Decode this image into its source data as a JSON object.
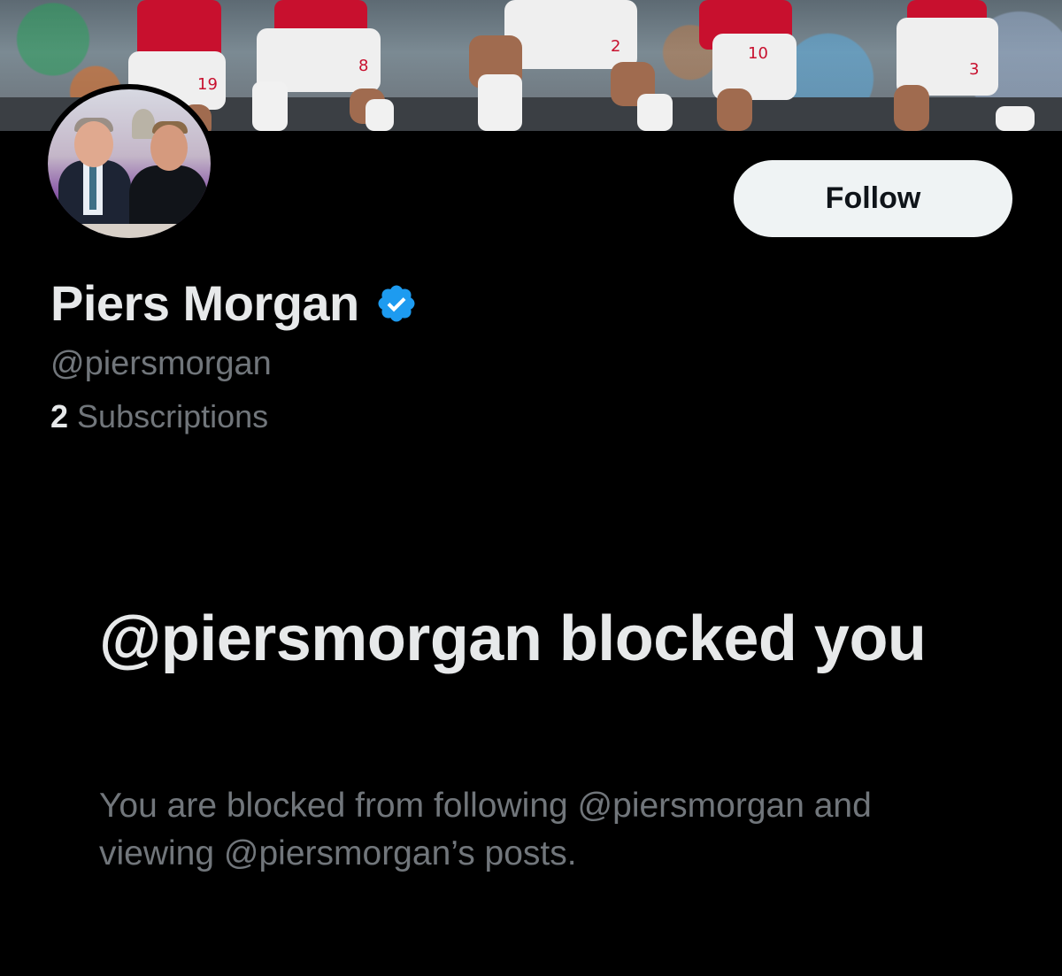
{
  "profile": {
    "display_name": "Piers Morgan",
    "handle": "@piersmorgan",
    "subscriptions_count": "2",
    "subscriptions_label": "Subscriptions",
    "verified": true
  },
  "actions": {
    "follow_label": "Follow"
  },
  "blocked": {
    "title": "@piersmorgan blocked you",
    "description": "You are blocked from following @piersmorgan and viewing @piersmorgan’s posts."
  },
  "banner": {
    "kit_numbers": [
      "19",
      "8",
      "2",
      "10",
      "3"
    ]
  },
  "colors": {
    "background": "#000000",
    "primary_text": "#e7e9ea",
    "secondary_text": "#71767b",
    "verified_blue": "#1d9bf0",
    "follow_button_bg": "#eff3f4",
    "kit_red": "#c8102e"
  },
  "icons": {
    "verified": "verified-badge-icon"
  }
}
